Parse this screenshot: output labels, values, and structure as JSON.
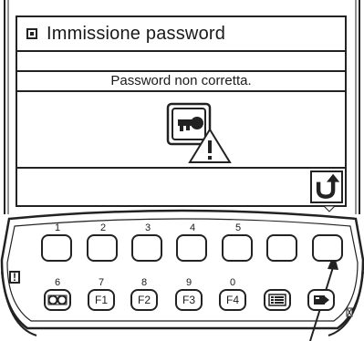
{
  "screen": {
    "title": "Immissione password",
    "message": "Password non corretta."
  },
  "keypad": {
    "top_row_numbers": [
      "1",
      "2",
      "3",
      "4",
      "5"
    ],
    "bottom_row_numbers": [
      "6",
      "7",
      "8",
      "9",
      "0"
    ],
    "function_labels": [
      "F1",
      "F2",
      "F3",
      "F4"
    ]
  },
  "indicators": {
    "warning_mark": "!"
  },
  "icons": {
    "title": "page-icon",
    "center": "key-with-warning-icon",
    "back": "undo-arrow-icon",
    "oo": "infinity-loop-icon",
    "menu": "list-menu-icon",
    "pen": "pen-marker-icon",
    "pointer": "callout-arrow"
  }
}
